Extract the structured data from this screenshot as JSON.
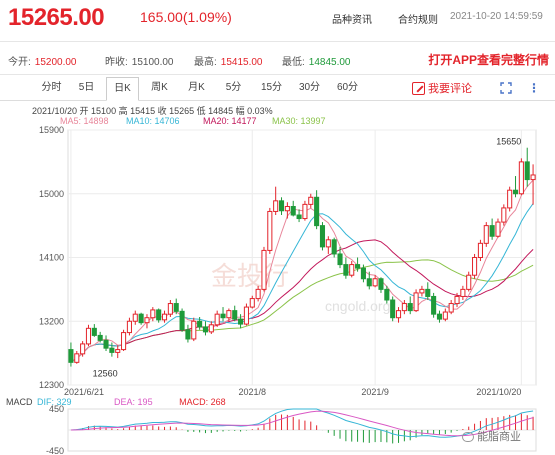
{
  "header": {
    "price": "15265.00",
    "change": "165.00(1.09%)",
    "link_news": "品种资讯",
    "link_rules": "合约规则",
    "timestamp": "2021-10-20 14:59:59"
  },
  "stats": [
    {
      "label": "今开:",
      "value": "15200.00",
      "color": "red"
    },
    {
      "label": "昨收:",
      "value": "15100.00",
      "color": "normal"
    },
    {
      "label": "最高:",
      "value": "15415.00",
      "color": "red"
    },
    {
      "label": "最低:",
      "value": "14845.00",
      "color": "green"
    }
  ],
  "promo": "打开APP查看完整行情",
  "tabs": [
    "分时",
    "5日",
    "日K",
    "周K",
    "月K",
    "5分",
    "15分",
    "30分",
    "60分"
  ],
  "active_tab": "日K",
  "comment_label": "我要评论",
  "ohlc_line": "2021/10/20  开 15100  高 15415  收 15265  低 14845  幅 0.03%",
  "ma_labels": {
    "ma5": "MA5: 14898",
    "ma10": "MA10: 14706",
    "ma20": "MA20: 14177",
    "ma30": "MA30: 13997"
  },
  "macd_labels": {
    "title": "MACD",
    "dif": "DIF: 329",
    "dea": "DEA: 195",
    "macd": "MACD: 268"
  },
  "watermark": {
    "brand": "金投行",
    "url": "cngold.org",
    "tag": "能脂商业"
  },
  "colors": {
    "up": "#e3242b",
    "down": "#1f9a3a",
    "ma5": "#e8869a",
    "ma10": "#36b6d6",
    "ma20": "#c2185b",
    "ma30": "#8bc34a",
    "dif": "#36b6d6",
    "dea": "#d957c4"
  },
  "chart_data": {
    "type": "candlestick",
    "ylim": [
      12300,
      15900
    ],
    "yticks": [
      15900,
      15000,
      14100,
      13200,
      12300
    ],
    "xticks": [
      {
        "index": 0,
        "label": "2021/6/21"
      },
      {
        "index": 31,
        "label": "2021/8"
      },
      {
        "index": 52,
        "label": "2021/9"
      },
      {
        "index": 77,
        "label": "2021/10/20"
      }
    ],
    "annotations": [
      {
        "index": 78,
        "value": 15650,
        "label": "15650"
      },
      {
        "index": 2,
        "value": 12560,
        "label": "12560"
      }
    ],
    "candles": [
      [
        12800,
        12900,
        12560,
        12620
      ],
      [
        12620,
        12780,
        12600,
        12740
      ],
      [
        12740,
        12920,
        12700,
        12880
      ],
      [
        12880,
        13150,
        12850,
        13100
      ],
      [
        13100,
        13160,
        12980,
        13000
      ],
      [
        13000,
        13050,
        12900,
        12930
      ],
      [
        12930,
        13000,
        12780,
        12820
      ],
      [
        12820,
        12900,
        12700,
        12760
      ],
      [
        12760,
        12860,
        12680,
        12800
      ],
      [
        12800,
        13080,
        12780,
        13040
      ],
      [
        13040,
        13250,
        13000,
        13200
      ],
      [
        13200,
        13350,
        13150,
        13300
      ],
      [
        13300,
        13320,
        13150,
        13180
      ],
      [
        13180,
        13300,
        13100,
        13250
      ],
      [
        13250,
        13400,
        13200,
        13360
      ],
      [
        13360,
        13380,
        13180,
        13220
      ],
      [
        13220,
        13350,
        13180,
        13300
      ],
      [
        13300,
        13500,
        13260,
        13450
      ],
      [
        13450,
        13520,
        13300,
        13340
      ],
      [
        13340,
        13380,
        13050,
        13080
      ],
      [
        13080,
        13150,
        12900,
        12950
      ],
      [
        12950,
        13250,
        12920,
        13200
      ],
      [
        13200,
        13260,
        13080,
        13120
      ],
      [
        13120,
        13200,
        13000,
        13050
      ],
      [
        13050,
        13200,
        13020,
        13150
      ],
      [
        13150,
        13350,
        13120,
        13300
      ],
      [
        13300,
        13400,
        13200,
        13250
      ],
      [
        13250,
        13380,
        13200,
        13350
      ],
      [
        13350,
        13420,
        13200,
        13230
      ],
      [
        13230,
        13300,
        13100,
        13160
      ],
      [
        13160,
        13450,
        13140,
        13400
      ],
      [
        13400,
        13560,
        13380,
        13520
      ],
      [
        13520,
        13700,
        13480,
        13650
      ],
      [
        13650,
        14250,
        13620,
        14200
      ],
      [
        14200,
        14800,
        14150,
        14750
      ],
      [
        14750,
        15100,
        14700,
        14900
      ],
      [
        14900,
        14950,
        14700,
        14760
      ],
      [
        14760,
        14880,
        14650,
        14820
      ],
      [
        14820,
        14900,
        14680,
        14700
      ],
      [
        14700,
        14780,
        14600,
        14650
      ],
      [
        14650,
        14900,
        14620,
        14850
      ],
      [
        14850,
        15000,
        14800,
        14950
      ],
      [
        14950,
        15050,
        14500,
        14550
      ],
      [
        14550,
        14600,
        14200,
        14250
      ],
      [
        14250,
        14400,
        14150,
        14350
      ],
      [
        14350,
        14380,
        14100,
        14150
      ],
      [
        14150,
        14250,
        13950,
        14000
      ],
      [
        14000,
        14100,
        13800,
        13850
      ],
      [
        13850,
        14050,
        13820,
        14000
      ],
      [
        14000,
        14100,
        13900,
        13950
      ],
      [
        13950,
        14000,
        13750,
        13800
      ],
      [
        13800,
        13900,
        13650,
        13700
      ],
      [
        13700,
        13850,
        13680,
        13800
      ],
      [
        13800,
        13820,
        13600,
        13650
      ],
      [
        13650,
        13700,
        13450,
        13500
      ],
      [
        13500,
        13550,
        13200,
        13250
      ],
      [
        13250,
        13400,
        13180,
        13350
      ],
      [
        13350,
        13500,
        13300,
        13450
      ],
      [
        13450,
        13550,
        13300,
        13350
      ],
      [
        13350,
        13650,
        13330,
        13600
      ],
      [
        13600,
        13700,
        13550,
        13650
      ],
      [
        13650,
        13750,
        13500,
        13550
      ],
      [
        13550,
        13600,
        13250,
        13300
      ],
      [
        13300,
        13350,
        13180,
        13230
      ],
      [
        13230,
        13380,
        13200,
        13330
      ],
      [
        13330,
        13500,
        13300,
        13450
      ],
      [
        13450,
        13600,
        13400,
        13550
      ],
      [
        13550,
        13700,
        13500,
        13650
      ],
      [
        13650,
        13900,
        13620,
        13850
      ],
      [
        13850,
        14150,
        13800,
        14100
      ],
      [
        14100,
        14350,
        14050,
        14300
      ],
      [
        14300,
        14600,
        14250,
        14550
      ],
      [
        14550,
        14650,
        14350,
        14400
      ],
      [
        14400,
        14650,
        14380,
        14600
      ],
      [
        14600,
        14850,
        14550,
        14800
      ],
      [
        14800,
        15100,
        14750,
        15050
      ],
      [
        15050,
        15250,
        14950,
        15000
      ],
      [
        15000,
        15500,
        14980,
        15450
      ],
      [
        15450,
        15650,
        15100,
        15200
      ],
      [
        15200,
        15415,
        14845,
        15265
      ]
    ],
    "macd": {
      "ylim": [
        -450,
        450
      ],
      "yticks": [
        450,
        -450
      ]
    }
  }
}
